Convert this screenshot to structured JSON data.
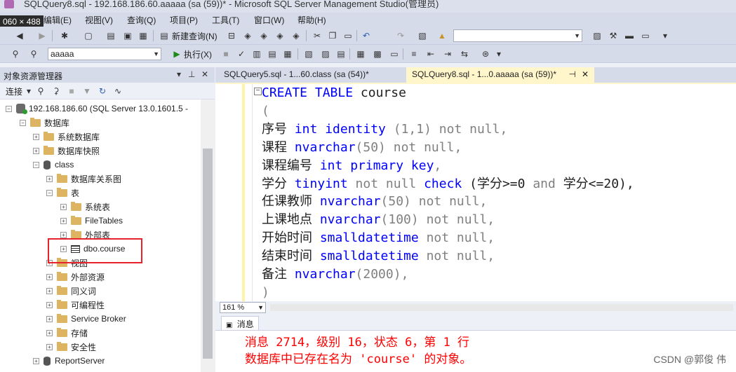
{
  "window": {
    "title": "SQLQuery8.sql - 192.168.186.60.aaaaa (sa (59))* - Microsoft SQL Server Management Studio(管理员)",
    "size_badge": "060 × 488"
  },
  "menu": {
    "items": [
      "编辑(E)",
      "视图(V)",
      "查询(Q)",
      "项目(P)",
      "工具(T)",
      "窗口(W)",
      "帮助(H)"
    ]
  },
  "toolbar": {
    "new_query": "新建查询(N)",
    "database": "aaaaa",
    "execute": "执行(X)",
    "search_value": ""
  },
  "object_explorer": {
    "title": "对象资源管理器",
    "connect": "连接",
    "tree": [
      {
        "label": "192.168.186.60 (SQL Server 13.0.1601.5 -",
        "level": 0,
        "icon": "server-icon",
        "expanded": true
      },
      {
        "label": "数据库",
        "level": 1,
        "icon": "folder-icon",
        "expanded": true
      },
      {
        "label": "系统数据库",
        "level": 2,
        "icon": "folder-icon",
        "expanded": false
      },
      {
        "label": "数据库快照",
        "level": 2,
        "icon": "folder-icon",
        "expanded": false
      },
      {
        "label": "class",
        "level": 2,
        "icon": "database-icon",
        "expanded": true
      },
      {
        "label": "数据库关系图",
        "level": 3,
        "icon": "folder-icon",
        "expanded": false
      },
      {
        "label": "表",
        "level": 3,
        "icon": "folder-icon",
        "expanded": true
      },
      {
        "label": "系统表",
        "level": 4,
        "icon": "folder-icon",
        "expanded": false
      },
      {
        "label": "FileTables",
        "level": 4,
        "icon": "folder-icon",
        "expanded": false
      },
      {
        "label": "外部表",
        "level": 4,
        "icon": "folder-icon",
        "expanded": false
      },
      {
        "label": "dbo.course",
        "level": 4,
        "icon": "table-icon",
        "expanded": false
      },
      {
        "label": "视图",
        "level": 3,
        "icon": "folder-icon",
        "expanded": false
      },
      {
        "label": "外部资源",
        "level": 3,
        "icon": "folder-icon",
        "expanded": false
      },
      {
        "label": "同义词",
        "level": 3,
        "icon": "folder-icon",
        "expanded": false
      },
      {
        "label": "可编程性",
        "level": 3,
        "icon": "folder-icon",
        "expanded": false
      },
      {
        "label": "Service Broker",
        "level": 3,
        "icon": "folder-icon",
        "expanded": false
      },
      {
        "label": "存储",
        "level": 3,
        "icon": "folder-icon",
        "expanded": false
      },
      {
        "label": "安全性",
        "level": 3,
        "icon": "folder-icon",
        "expanded": false
      },
      {
        "label": "ReportServer",
        "level": 2,
        "icon": "database-icon",
        "expanded": false
      }
    ]
  },
  "tabs": [
    {
      "label": "SQLQuery5.sql - 1...60.class (sa (54))*",
      "active": false
    },
    {
      "label": "SQLQuery8.sql - 1...0.aaaaa (sa (59))*",
      "active": true
    }
  ],
  "editor": {
    "line1": {
      "kw1": "CREATE",
      "kw2": "TABLE",
      "name": "course"
    },
    "line2": "(",
    "line3": {
      "name": "序号",
      "type": "int",
      "kw": "identity",
      "args": "(1,1)",
      "tail": "not null,"
    },
    "line4": {
      "name": "课程",
      "type": "nvarchar",
      "args": "(50)",
      "tail": "not null,"
    },
    "line5": {
      "name": "课程编号",
      "type": "int",
      "kw": "primary key",
      "tail": ","
    },
    "line6": {
      "name": "学分",
      "type": "tinyint",
      "tail1": "not null",
      "kw": "check",
      "expr1": "(学分>=0",
      "op": "and",
      "expr2": "学分<=20),"
    },
    "line7": {
      "name": "任课教师",
      "type": "nvarchar",
      "args": "(50)",
      "tail": "not null,"
    },
    "line8": {
      "name": "上课地点",
      "type": "nvarchar",
      "args": "(100)",
      "tail": "not null,"
    },
    "line9": {
      "name": "开始时间",
      "type": "smalldatetime",
      "tail": "not null,"
    },
    "line10": {
      "name": "结束时间",
      "type": "smalldatetime",
      "tail": "not null,"
    },
    "line11": {
      "name": "备注",
      "type": "nvarchar",
      "args": "(2000),"
    },
    "line12": ")"
  },
  "zoom": "161 %",
  "messages": {
    "tab_label": "消息",
    "line1": "消息 2714，级别 16，状态 6，第 1 行",
    "line2": "数据库中已存在名为 'course' 的对象。"
  },
  "watermark": "CSDN @郭俊 伟"
}
